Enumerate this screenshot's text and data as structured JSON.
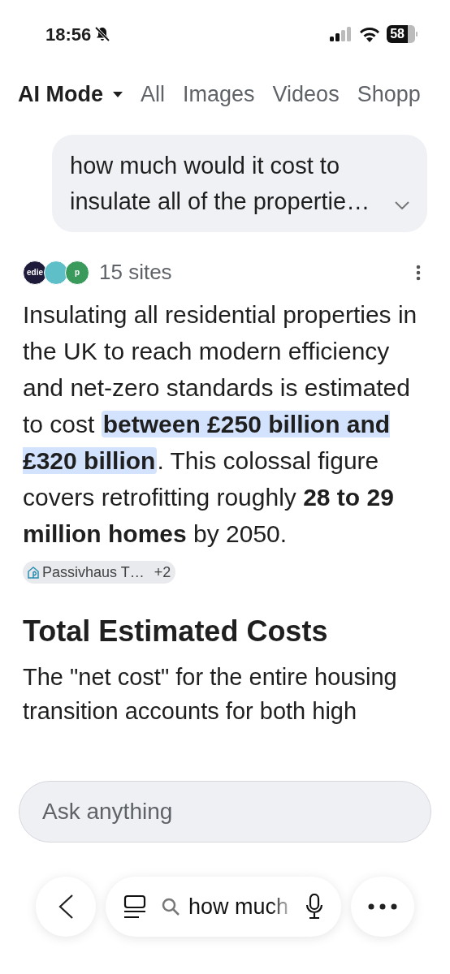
{
  "status_bar": {
    "time": "18:56",
    "battery": "58"
  },
  "tabs": [
    {
      "label": "AI Mode",
      "selected": true,
      "dropdown": true
    },
    {
      "label": "All",
      "selected": false,
      "dropdown": false
    },
    {
      "label": "Images",
      "selected": false,
      "dropdown": false
    },
    {
      "label": "Videos",
      "selected": false,
      "dropdown": false
    },
    {
      "label": "Shopp",
      "selected": false,
      "dropdown": false
    }
  ],
  "query": {
    "text": "how much would it cost to insulate all of the propertie…",
    "expanded": false
  },
  "sources": {
    "logos": [
      {
        "text": "edie",
        "color": "#1e1b3a"
      },
      {
        "color": "#5fbfc9"
      },
      {
        "text": "p",
        "color": "#3a9a5c"
      }
    ],
    "count": "15 sites"
  },
  "answer": {
    "segments": [
      {
        "text": "Insulating all residential properties in the UK to reach modern efficiency and net-zero standards is estimated to cost ",
        "bold": false,
        "highlight": false
      },
      {
        "text": "between £250 billion and £320 billion",
        "bold": true,
        "highlight": true
      },
      {
        "text": ". This colossal figure covers retrofitting roughly ",
        "bold": false,
        "highlight": false
      },
      {
        "text": "28 to 29 million homes",
        "bold": true,
        "highlight": false
      },
      {
        "text": " by 2050.",
        "bold": false,
        "highlight": false
      }
    ],
    "citation": {
      "label": "Passivhaus T…",
      "more": "+2"
    }
  },
  "heading": "Total Estimated Costs",
  "paragraph": "The \"net cost\" for the entire housing transition accounts for both high",
  "ask_field": {
    "placeholder": "Ask anything"
  },
  "bottom_bar": {
    "search_text": "how much"
  }
}
